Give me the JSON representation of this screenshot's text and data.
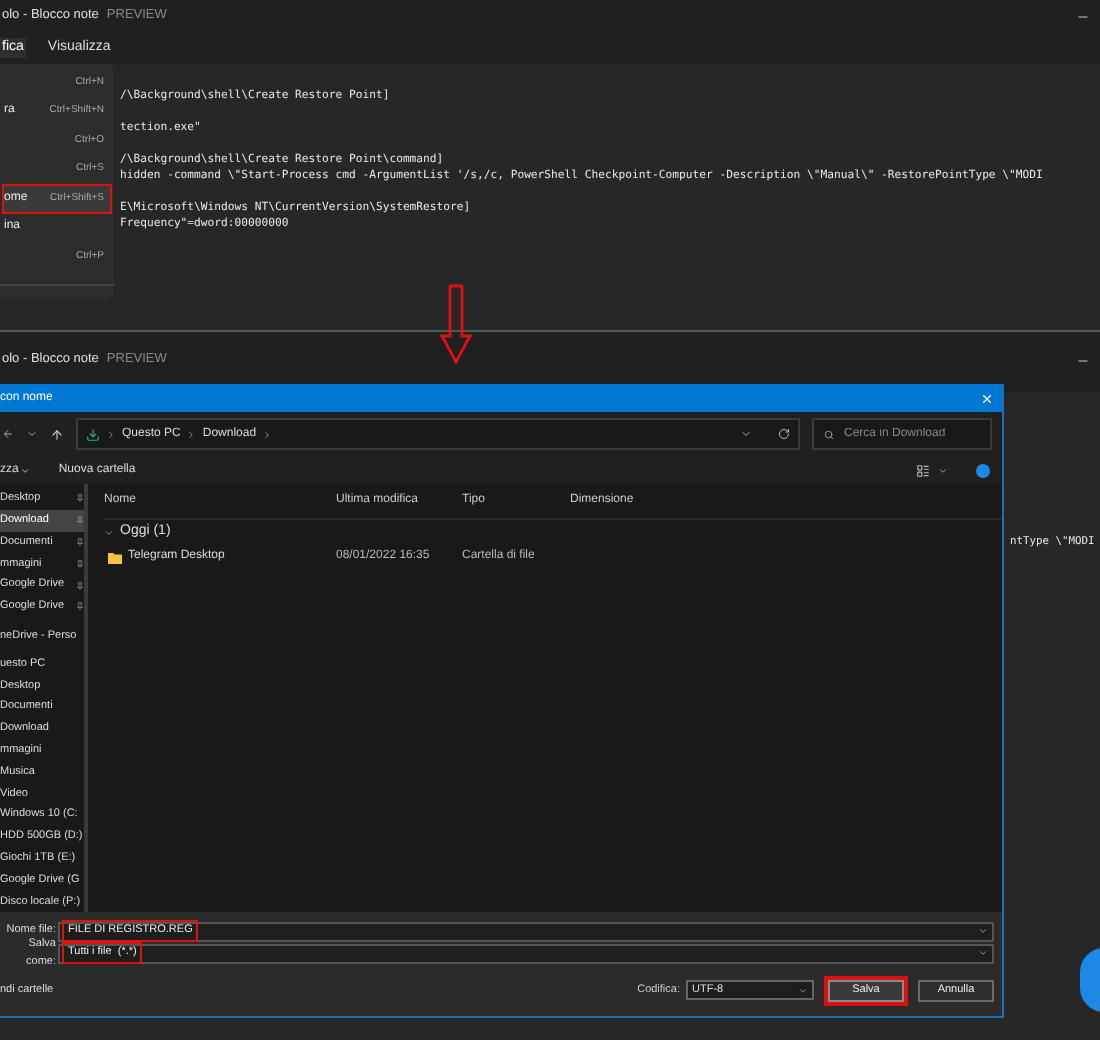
{
  "top_window": {
    "title": "olo - Blocco note",
    "badge": "PREVIEW",
    "menu": [
      {
        "label": "fica",
        "selected": true
      },
      {
        "label": "Visualizza",
        "selected": false
      }
    ],
    "editor_blocks": [
      [
        "/\\Background\\shell\\Create Restore Point]"
      ],
      [
        "tection.exe\""
      ],
      [
        "/\\Background\\shell\\Create Restore Point\\command]",
        "hidden -command \\\"Start-Process cmd -ArgumentList '/s,/c, PowerShell Checkpoint-Computer -Description \\\"Manual\\\" -RestorePointType \\\"MODI"
      ],
      [
        "E\\Microsoft\\Windows NT\\CurrentVersion\\SystemRestore]",
        "Frequency\"=dword:00000000"
      ]
    ],
    "file_menu": [
      {
        "shortcut": "Ctrl+N",
        "highlighted": false
      },
      {
        "label": "ra",
        "shortcut": "Ctrl+Shift+N",
        "highlighted": false
      },
      {
        "shortcut": "Ctrl+O",
        "highlighted": false
      },
      {
        "shortcut": "Ctrl+S",
        "highlighted": false
      },
      {
        "label": "ome",
        "shortcut": "Ctrl+Shift+S",
        "highlighted": true
      },
      {
        "label": "ina",
        "highlighted": false
      },
      {
        "shortcut": "Ctrl+P",
        "highlighted": false
      }
    ]
  },
  "bottom_window": {
    "title": "olo - Blocco note",
    "badge": "PREVIEW",
    "editor_line": "ntType \\\"MODI"
  },
  "save_dialog": {
    "title": "con nome",
    "address": [
      "Questo PC",
      "Download"
    ],
    "search": {
      "placeholder": "Cerca in Download"
    },
    "toolbar": [
      "zza",
      "Nuova cartella"
    ],
    "sidebar_groups": [
      {
        "items": [
          {
            "label": "Desktop",
            "pinned": true,
            "selected": false
          },
          {
            "label": "Download",
            "pinned": true,
            "selected": true
          },
          {
            "label": "Documenti",
            "pinned": true,
            "selected": false
          },
          {
            "label": "mmagini",
            "pinned": true,
            "selected": false
          },
          {
            "label": "Google Drive",
            "pinned": true,
            "selected": false
          },
          {
            "label": "Google Drive",
            "pinned": true,
            "selected": false
          }
        ]
      },
      {
        "items": [
          {
            "label": "neDrive - Perso",
            "pinned": false,
            "selected": false
          }
        ]
      },
      {
        "items": [
          {
            "label": "uesto PC",
            "pinned": false,
            "selected": false
          },
          {
            "label": "Desktop",
            "pinned": false,
            "selected": false
          },
          {
            "label": "Documenti",
            "pinned": false,
            "selected": false
          },
          {
            "label": "Download",
            "pinned": false,
            "selected": false
          },
          {
            "label": "mmagini",
            "pinned": false,
            "selected": false
          },
          {
            "label": "Musica",
            "pinned": false,
            "selected": false
          },
          {
            "label": "Video",
            "pinned": false,
            "selected": false
          },
          {
            "label": "Windows 10 (C:",
            "pinned": false,
            "selected": false
          },
          {
            "label": "HDD 500GB (D:)",
            "pinned": false,
            "selected": false
          },
          {
            "label": "Giochi 1TB (E:)",
            "pinned": false,
            "selected": false
          },
          {
            "label": "Google Drive (G",
            "pinned": false,
            "selected": false
          },
          {
            "label": "Disco locale (P:)",
            "pinned": false,
            "selected": false
          }
        ]
      }
    ],
    "columns": [
      "Nome",
      "Ultima modifica",
      "Tipo",
      "Dimensione"
    ],
    "group": "Oggi (1)",
    "rows": [
      {
        "name": "Telegram Desktop",
        "modified": "08/01/2022 16:35",
        "type": "Cartella di file"
      }
    ],
    "filename": {
      "label": "Nome file:",
      "value": "FILE DI REGISTRO.REG",
      "highlighted": true
    },
    "savetype": {
      "label": "Salva come:",
      "value": "Tutti i file  (*.*)",
      "highlighted": true
    },
    "hide_folders": "ndi cartelle",
    "encoding": {
      "label": "Codifica:",
      "value": "UTF-8"
    },
    "buttons": [
      {
        "label": "Salva",
        "kind": "primary",
        "highlighted": true
      },
      {
        "label": "Annulla",
        "kind": "secondary",
        "highlighted": false
      }
    ]
  }
}
